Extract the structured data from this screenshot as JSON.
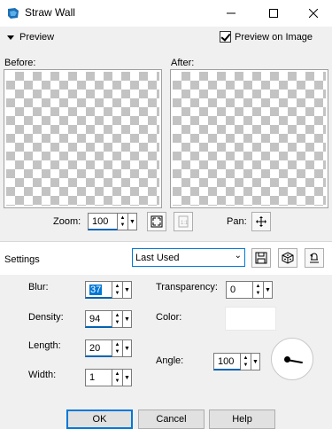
{
  "window": {
    "title": "Straw Wall",
    "app_icon": "app-icon",
    "controls": {
      "minimize": "─",
      "maximize": "☐",
      "close": "✕"
    }
  },
  "preview": {
    "toggle_label": "Preview",
    "preview_on_image_label": "Preview on Image",
    "preview_on_image_checked": true,
    "before_label": "Before:",
    "after_label": "After:"
  },
  "zoom": {
    "label": "Zoom:",
    "value": "100",
    "pan_label": "Pan:"
  },
  "settings": {
    "label": "Settings",
    "preset_value": "Last Used"
  },
  "fields": {
    "blur": {
      "label": "Blur:",
      "value": "37"
    },
    "density": {
      "label": "Density:",
      "value": "94"
    },
    "length": {
      "label": "Length:",
      "value": "20"
    },
    "width": {
      "label": "Width:",
      "value": "1"
    },
    "transparency": {
      "label": "Transparency:",
      "value": "0"
    },
    "color": {
      "label": "Color:",
      "value": "#ffffff"
    },
    "angle": {
      "label": "Angle:",
      "value": "100"
    }
  },
  "buttons": {
    "ok": "OK",
    "cancel": "Cancel",
    "help": "Help"
  },
  "colors": {
    "accent": "#0078d7",
    "checker_dark": "#c3c3c3",
    "checker_light": "#ffffff"
  }
}
